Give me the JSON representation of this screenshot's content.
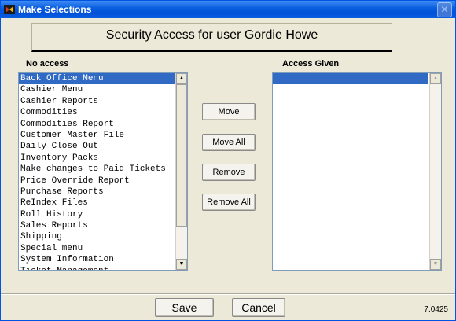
{
  "window": {
    "title": "Make Selections",
    "close_glyph": "✕",
    "icon": "app-logo-icon"
  },
  "heading": "Security Access for user Gordie Howe",
  "left_list": {
    "label": "No access",
    "items": [
      "Back Office Menu",
      "Cashier Menu",
      "Cashier Reports",
      "Commodities",
      "Commodities Report",
      "Customer Master File",
      "Daily Close Out",
      "Inventory Packs",
      "Make changes to Paid Tickets",
      "Price Override Report",
      "Purchase Reports",
      "ReIndex Files",
      "Roll History",
      "Sales Reports",
      "Shipping",
      "Special menu",
      "System Information",
      "Ticket Management"
    ],
    "selected_index": 0
  },
  "right_list": {
    "label": "Access Given",
    "items": [
      ""
    ],
    "selected_index": 0
  },
  "buttons": {
    "move": "Move",
    "move_all": "Move All",
    "remove": "Remove",
    "remove_all": "Remove All"
  },
  "footer": {
    "save": "Save",
    "cancel": "Cancel",
    "version": "7.0425"
  },
  "colors": {
    "titlebar": "#0a5fe0",
    "selection": "#316ac5",
    "background": "#ece9d8"
  }
}
